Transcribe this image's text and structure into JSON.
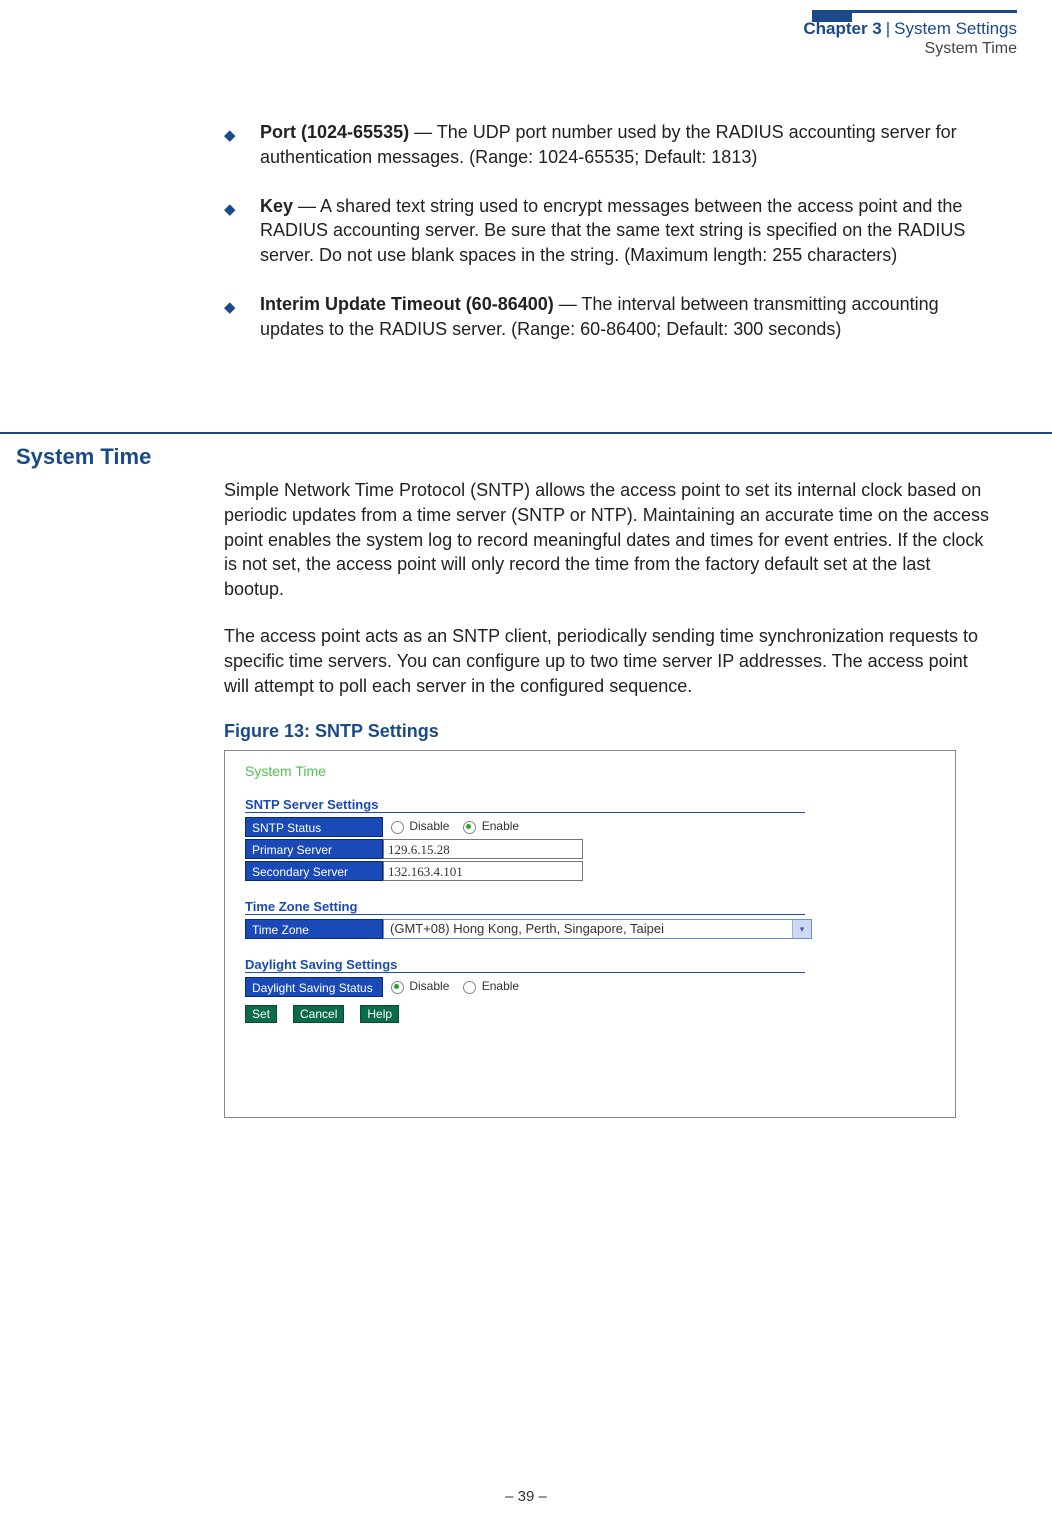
{
  "header": {
    "chapter_label": "Chapter 3",
    "chapter_title": "System Settings",
    "subtitle": "System Time"
  },
  "bullets": {
    "port": {
      "term": "Port (1024-65535)",
      "text": " — The UDP port number used by the RADIUS accounting server for authentication messages. (Range: 1024-65535; Default: 1813)"
    },
    "key": {
      "term": "Key",
      "text": " — A shared text string used to encrypt messages between the access point and the RADIUS accounting server. Be sure that the same text string is specified on the RADIUS server. Do not use blank spaces in the string. (Maximum length: 255 characters)"
    },
    "interim": {
      "term": "Interim Update Timeout (60-86400)",
      "text": " — The interval between transmitting accounting updates to the RADIUS server. (Range: 60-86400; Default: 300 seconds)"
    }
  },
  "section": {
    "heading": "System Time",
    "p1": "Simple Network Time Protocol (SNTP) allows the access point to set its internal clock based on periodic updates from a time server (SNTP or NTP). Maintaining an accurate time on the access point enables the system log to record meaningful dates and times for event entries. If the clock is not set, the access point will only record the time from the factory default set at the last bootup.",
    "p2": "The access point acts as an SNTP client, periodically sending time synchronization requests to specific time servers. You can configure up to two time server IP addresses. The access point will attempt to poll each server in the configured sequence."
  },
  "figure": {
    "caption": "Figure 13:  SNTP Settings",
    "title": "System Time",
    "sntp": {
      "heading": "SNTP Server Settings",
      "status_label": "SNTP Status",
      "disable": "Disable",
      "enable": "Enable",
      "primary_label": "Primary Server",
      "primary_value": "129.6.15.28",
      "secondary_label": "Secondary Server",
      "secondary_value": "132.163.4.101"
    },
    "tz": {
      "heading": "Time Zone Setting",
      "label": "Time Zone",
      "value": "(GMT+08) Hong Kong, Perth, Singapore, Taipei"
    },
    "ds": {
      "heading": "Daylight Saving Settings",
      "label": "Daylight Saving Status",
      "disable": "Disable",
      "enable": "Enable"
    },
    "buttons": {
      "set": "Set",
      "cancel": "Cancel",
      "help": "Help"
    }
  },
  "footer": {
    "page": "–  39  –"
  }
}
